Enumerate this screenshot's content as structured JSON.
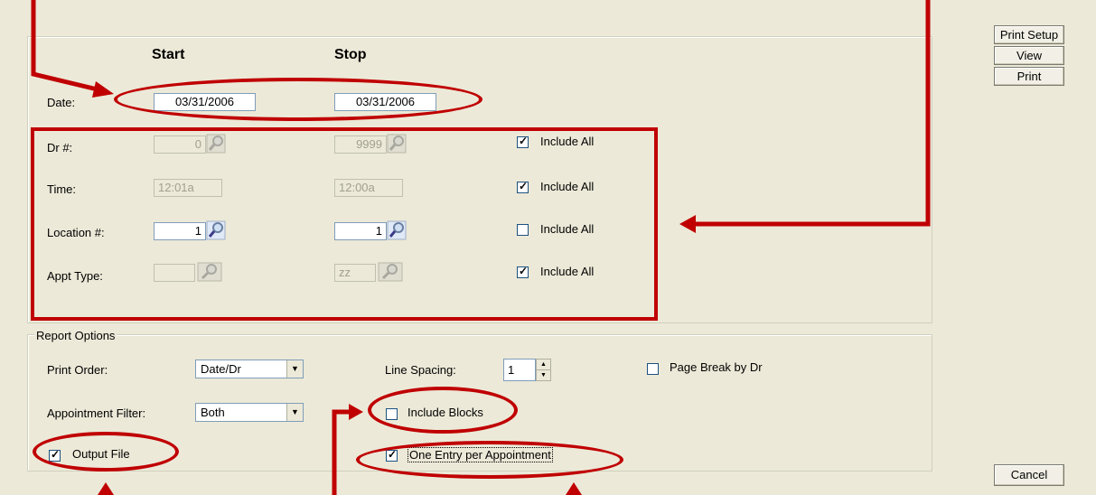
{
  "headers": {
    "start": "Start",
    "stop": "Stop"
  },
  "labels": {
    "date": "Date:",
    "dr": "Dr #:",
    "time": "Time:",
    "location": "Location #:",
    "appt_type": "Appt Type:"
  },
  "date": {
    "start": "03/31/2006",
    "stop": "03/31/2006"
  },
  "dr": {
    "start": "0",
    "stop": "9999",
    "include_all_label": "Include All",
    "include_all": true
  },
  "time": {
    "start": "12:01a",
    "stop": "12:00a",
    "include_all_label": "Include All",
    "include_all": true
  },
  "location": {
    "start": "1",
    "stop": "1",
    "include_all_label": "Include All",
    "include_all": false
  },
  "appt_type": {
    "start": "",
    "stop": "zz",
    "include_all_label": "Include All",
    "include_all": true
  },
  "report_options": {
    "legend": "Report Options",
    "print_order_label": "Print Order:",
    "print_order_value": "Date/Dr",
    "appointment_filter_label": "Appointment Filter:",
    "appointment_filter_value": "Both",
    "line_spacing_label": "Line Spacing:",
    "line_spacing_value": "1",
    "page_break_label": "Page Break by Dr",
    "page_break": false,
    "include_blocks_label": "Include Blocks",
    "include_blocks": false,
    "output_file_label": "Output File",
    "output_file": true,
    "one_entry_label": "One Entry per Appointment",
    "one_entry": true
  },
  "buttons": {
    "print_setup": "Print Setup",
    "view": "View",
    "print": "Print",
    "cancel": "Cancel"
  },
  "colors": {
    "annotation": "#c00000",
    "background": "#ece9d8"
  }
}
